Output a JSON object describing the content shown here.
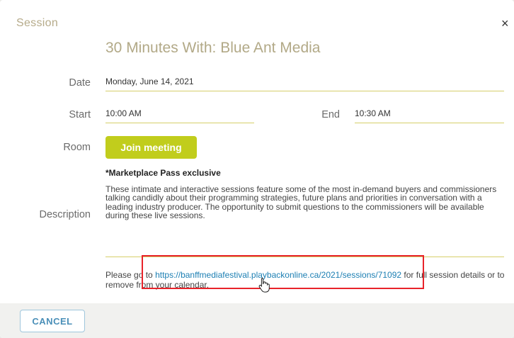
{
  "dialog": {
    "title": "Session",
    "close_glyph": "×"
  },
  "session": {
    "title": "30 Minutes With: Blue Ant Media",
    "date_label": "Date",
    "date_value": "Monday, June 14, 2021",
    "start_label": "Start",
    "start_value": "10:00 AM",
    "end_label": "End",
    "end_value": "10:30 AM",
    "room_label": "Room",
    "join_label": "Join meeting",
    "description_label": "Description",
    "exclusive_note": "*Marketplace Pass exclusive",
    "description_text": "These intimate and interactive sessions feature some of the most in-demand buyers and commissioners talking candidly about their programming strategies, future plans and priorities in conversation with a leading industry producer. The opportunity to submit questions to the commissioners will be available during these live sessions.",
    "footer_prefix": "Please go to ",
    "footer_link": "https://banffmediafestival.playbackonline.ca/2021/sessions/71092",
    "footer_suffix": " for full session details or to remove from your calendar."
  },
  "footer": {
    "cancel_label": "CANCEL"
  },
  "colors": {
    "accent_lime": "#c1cd1c",
    "title_tan": "#b2a987",
    "link_blue": "#1c7fb3",
    "highlight_red": "#e8232a"
  },
  "icons": {
    "close": "close-icon",
    "cursor": "hand-pointer-icon"
  }
}
